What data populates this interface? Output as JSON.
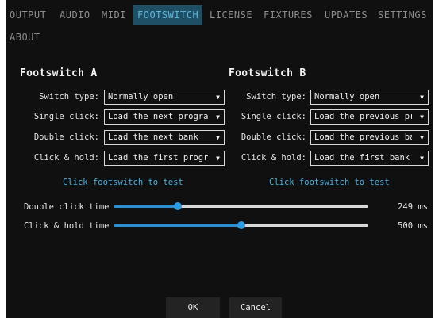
{
  "tabs": [
    {
      "label": "OUTPUT",
      "active": false
    },
    {
      "label": "AUDIO",
      "active": false
    },
    {
      "label": "MIDI",
      "active": false
    },
    {
      "label": "FOOTSWITCH",
      "active": true
    },
    {
      "label": "LICENSE",
      "active": false
    },
    {
      "label": "FIXTURES",
      "active": false
    },
    {
      "label": "UPDATES",
      "active": false
    },
    {
      "label": "SETTINGS",
      "active": false
    },
    {
      "label": "ABOUT",
      "active": false
    }
  ],
  "footswitch_a": {
    "title": "Footswitch A",
    "switch_type_label": "Switch type:",
    "switch_type_value": "Normally open",
    "single_click_label": "Single click:",
    "single_click_value": "Load the next program",
    "double_click_label": "Double click:",
    "double_click_value": "Load the next bank",
    "click_hold_label": "Click & hold:",
    "click_hold_value": "Load the first program",
    "test_link": "Click footswitch to test"
  },
  "footswitch_b": {
    "title": "Footswitch B",
    "switch_type_label": "Switch type:",
    "switch_type_value": "Normally open",
    "single_click_label": "Single click:",
    "single_click_value": "Load the previous program",
    "double_click_label": "Double click:",
    "double_click_value": "Load the previous bank",
    "click_hold_label": "Click & hold:",
    "click_hold_value": "Load the first bank",
    "test_link": "Click footswitch to test"
  },
  "sliders": {
    "double_click_time": {
      "label": "Double click time",
      "value": "249 ms",
      "fraction": 0.25
    },
    "click_hold_time": {
      "label": "Click & hold time",
      "value": "500 ms",
      "fraction": 0.5
    }
  },
  "buttons": {
    "ok": "OK",
    "cancel": "Cancel"
  },
  "colors": {
    "background": "#101010",
    "accent": "#2d9be0",
    "active_tab_bg": "#1f4f64",
    "active_tab_text": "#5fb6dd",
    "link": "#4eb1e3"
  },
  "icons": {
    "dropdown": "caret-down-icon",
    "slider_handle": "slider-knob"
  }
}
